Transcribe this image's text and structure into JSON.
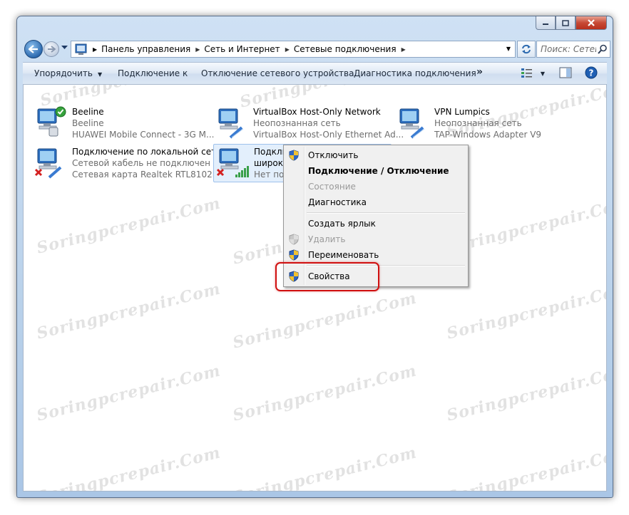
{
  "window": {
    "title_buttons": {
      "minimize": "minimize-icon",
      "maximize": "maximize-icon",
      "close": "close-icon"
    }
  },
  "address": {
    "crumbs": [
      "Панель управления",
      "Сеть и Интернет",
      "Сетевые подключения"
    ],
    "search_placeholder": "Поиск: Сетев..."
  },
  "toolbar": {
    "organize": "Упорядочить",
    "connect_to": "Подключение к",
    "disable_device": "Отключение сетевого устройства",
    "diagnose": "Диагностика подключения",
    "more": "»"
  },
  "connections": [
    {
      "name": "Beeline",
      "status": "Beeline",
      "device": "HUAWEI Mobile Connect - 3G M...",
      "state": "connected"
    },
    {
      "name": "VirtualBox Host-Only Network",
      "status": "Неопознанная сеть",
      "device": "VirtualBox Host-Only Ethernet Ad...",
      "state": "ok"
    },
    {
      "name": "VPN Lumpics",
      "status": "Неопознанная сеть",
      "device": "TAP-Windows Adapter V9",
      "state": "ok"
    },
    {
      "name": "Подключение по локальной сети",
      "status": "Сетевой кабель не подключен",
      "device": "Сетевая карта Realtek RTL8102E/...",
      "state": "disconnected"
    },
    {
      "name": "Подключение через адаптер",
      "status": "широкополосной мобильной с...",
      "device": "Нет подключения",
      "state": "disconnected"
    }
  ],
  "context_menu": {
    "items": [
      {
        "label": "Отключить",
        "icon": "uac-shield-icon"
      },
      {
        "label": "Подключение / Отключение",
        "default": true
      },
      {
        "label": "Состояние",
        "disabled": true
      },
      {
        "label": "Диагностика"
      },
      {
        "label": "Создать ярлык"
      },
      {
        "label": "Удалить",
        "icon": "uac-shield-icon",
        "disabled": true
      },
      {
        "label": "Переименовать",
        "icon": "uac-shield-icon"
      },
      {
        "label": "Свойства",
        "icon": "uac-shield-icon",
        "highlighted": true
      }
    ]
  },
  "watermark": "Soringpcrepair.Com",
  "colors": {
    "highlight": "#d01010",
    "selection": "#e3effc",
    "accent": "#2e6bb0"
  }
}
